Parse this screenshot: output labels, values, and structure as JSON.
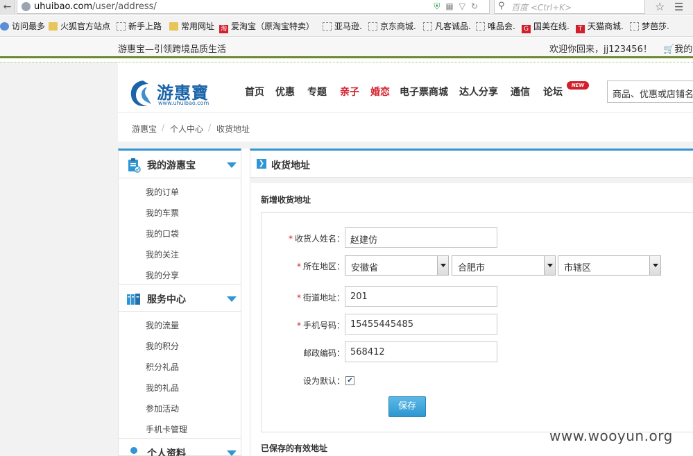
{
  "browser": {
    "url_prefix": "uhuibao.com",
    "url_path": "/user/address/",
    "search_placeholder": "百度 <Ctrl+K>",
    "bookmarks": [
      "访问最多",
      "火狐官方站点",
      "新手上路",
      "常用网址",
      "爱淘宝（原淘宝特卖）",
      "亚马逊.",
      "京东商城.",
      "凡客诚品.",
      "唯品会.",
      "国美在线.",
      "天猫商城.",
      "梦芭莎."
    ]
  },
  "topbar": {
    "slogan": "游惠宝—引领跨境品质生活",
    "welcome": "欢迎你回来，jj123456！",
    "cart": "我的"
  },
  "header": {
    "logo_text": "游惠寶",
    "logo_url": "www.uhuibao.com",
    "nav": [
      "首页",
      "优惠",
      "专题",
      "亲子",
      "婚恋",
      "电子票商城",
      "达人分享",
      "通信",
      "论坛"
    ],
    "new_badge": "NEW",
    "search_placeholder": "商品、优惠或店铺名"
  },
  "breadcrumb": [
    "游惠宝",
    "个人中心",
    "收货地址"
  ],
  "sidebar": {
    "sections": [
      {
        "title": "我的游惠宝",
        "items": [
          "我的订单",
          "我的车票",
          "我的口袋",
          "我的关注",
          "我的分享"
        ]
      },
      {
        "title": "服务中心",
        "items": [
          "我的流量",
          "我的积分",
          "积分礼品",
          "我的礼品",
          "参加活动",
          "手机卡管理"
        ]
      },
      {
        "title": "个人资料",
        "items": []
      }
    ]
  },
  "main": {
    "title": "收货地址",
    "section_title": "新增收货地址",
    "form": {
      "name_label": "收货人姓名：",
      "name_value": "赵建仿",
      "region_label": "所在地区：",
      "province": "安徽省",
      "city": "合肥市",
      "district": "市辖区",
      "street_label": "街道地址：",
      "street_value": "201",
      "phone_label": "手机号码：",
      "phone_value": "15455445485",
      "zip_label": "邮政编码：",
      "zip_value": "568412",
      "default_label": "设为默认：",
      "default_checked": true,
      "save_label": "保存"
    },
    "saved_title": "已保存的有效地址"
  },
  "watermark": "www.wooyun.org",
  "colors": {
    "accent": "#2f95d4",
    "red": "#d21f2c",
    "green_line": "#6b8a2f"
  }
}
